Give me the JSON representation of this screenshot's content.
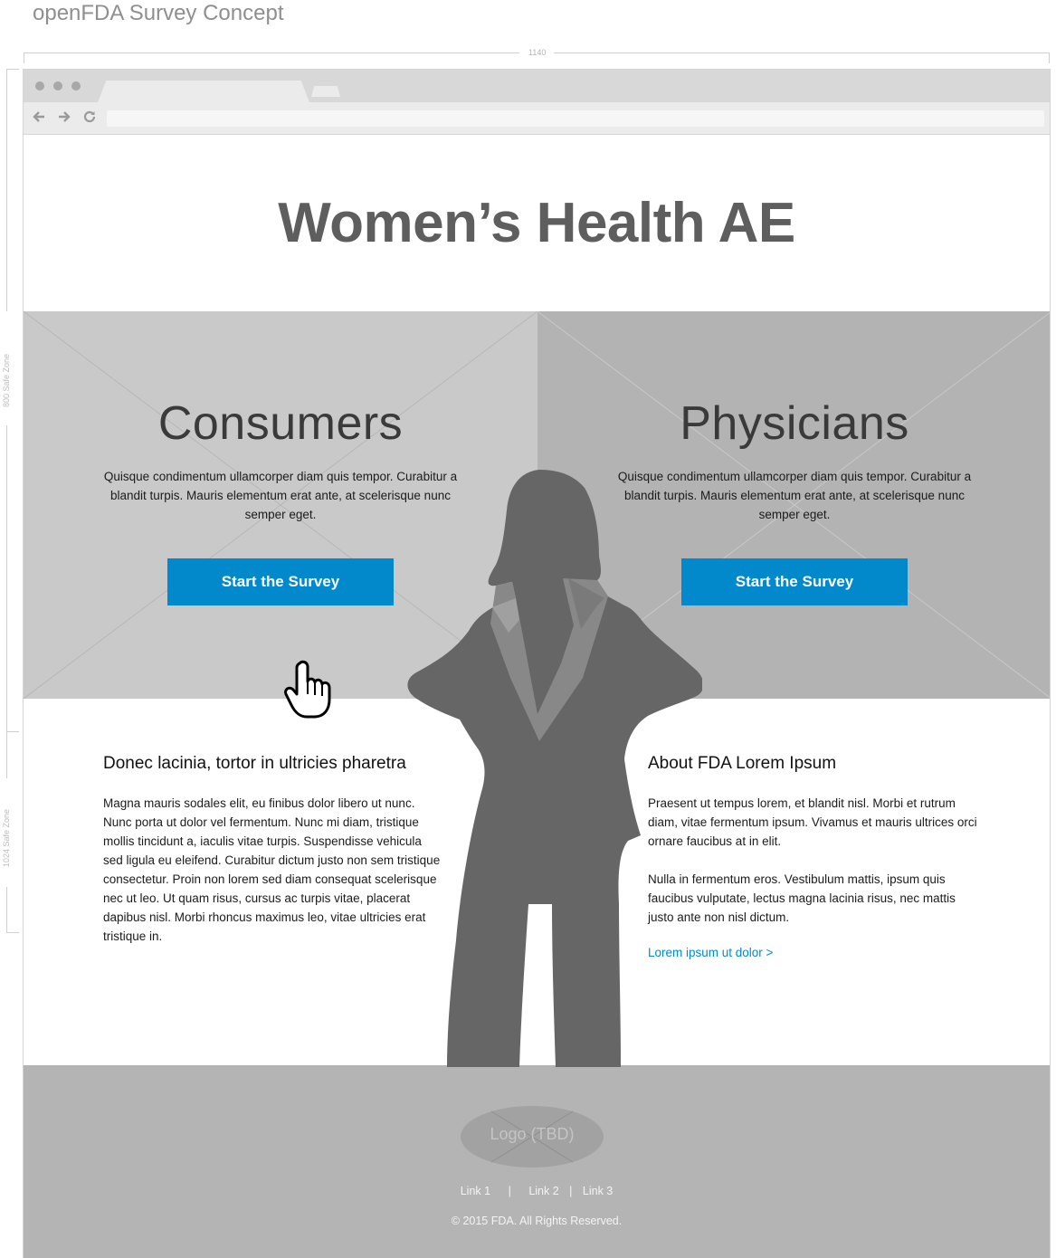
{
  "concept_title": "openFDA Survey Concept",
  "ruler": {
    "width_label": "1140",
    "safe_zone_800": "800 Safe Zone",
    "safe_zone_1024": "1024 Safe Zone"
  },
  "page": {
    "heading": "Women’s Health AE"
  },
  "consumers": {
    "title": "Consumers",
    "text": "Quisque condimentum ullamcorper diam quis tempor. Curabitur a blandit turpis. Mauris elementum erat ante, at scelerisque nunc semper eget.",
    "button_label": "Start the Survey"
  },
  "physicians": {
    "title": "Physicians",
    "text": "Quisque condimentum ullamcorper diam quis tempor. Curabitur a blandit turpis. Mauris elementum erat ante, at scelerisque nunc semper eget.",
    "button_label": "Start the Survey"
  },
  "left_section": {
    "heading": "Donec lacinia, tortor in ultricies pharetra",
    "body": "Magna mauris sodales elit, eu finibus dolor libero ut nunc. Nunc porta ut dolor vel fermentum. Nunc mi diam, tristique mollis tincidunt a, iaculis vitae turpis. Suspendisse vehicula sed ligula eu eleifend. Curabitur dictum justo non sem tristique consectetur. Proin non lorem sed diam consequat scelerisque nec ut leo. Ut quam risus, cursus ac turpis vitae, placerat dapibus nisl. Morbi rhoncus maximus leo, vitae ultricies erat tristique in."
  },
  "right_section": {
    "heading": "About FDA Lorem Ipsum",
    "paragraph1": "Praesent ut tempus lorem, et blandit nisl. Morbi et rutrum diam, vitae fermentum ipsum. Vivamus et mauris ultrices orci ornare faucibus at in elit.",
    "paragraph2": "Nulla in fermentum eros. Vestibulum mattis, ipsum quis faucibus vulputate, lectus magna lacinia risus, nec mattis justo ante non nisl dictum.",
    "link": "Lorem ipsum ut dolor >"
  },
  "footer": {
    "logo": "Logo (TBD)",
    "links": [
      "Link 1",
      "Link 2",
      "Link 3"
    ],
    "separator": "|",
    "copyright": "© 2015 FDA. All Rights Reserved."
  },
  "colors": {
    "accent": "#0289cc",
    "silhouette": "#666666",
    "footer": "#b4b4b4"
  },
  "icons": [
    "back-arrow-icon",
    "forward-arrow-icon",
    "reload-icon",
    "hand-pointer-icon",
    "woman-silhouette"
  ]
}
